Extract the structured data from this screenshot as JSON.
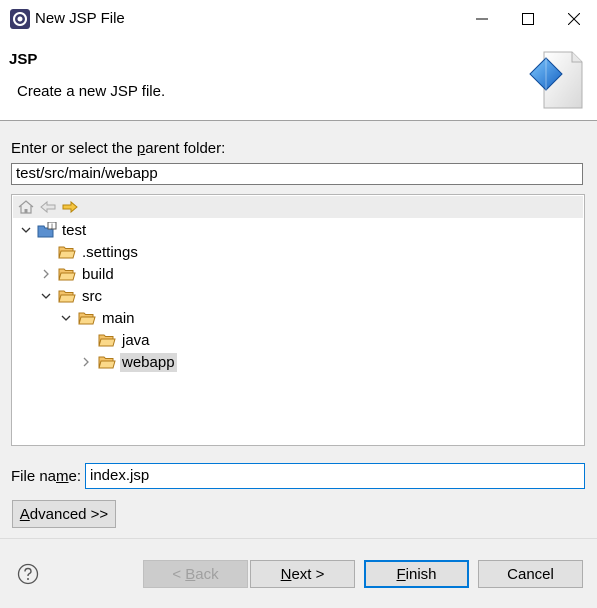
{
  "window": {
    "title": "New JSP File"
  },
  "banner": {
    "title": "JSP",
    "description": "Create a new JSP file."
  },
  "folder": {
    "label_prefix": "Enter or select the ",
    "label_mnemonic": "p",
    "label_suffix": "arent folder:",
    "value": "test/src/main/webapp"
  },
  "tree": {
    "nodes": [
      {
        "label": "test",
        "level": 0,
        "expanded": true,
        "icon": "project-icon"
      },
      {
        "label": ".settings",
        "level": 1,
        "expanded": null,
        "icon": "folder-icon"
      },
      {
        "label": "build",
        "level": 1,
        "expanded": false,
        "icon": "folder-icon"
      },
      {
        "label": "src",
        "level": 1,
        "expanded": true,
        "icon": "folder-icon"
      },
      {
        "label": "main",
        "level": 2,
        "expanded": true,
        "icon": "folder-icon"
      },
      {
        "label": "java",
        "level": 3,
        "expanded": null,
        "icon": "folder-icon"
      },
      {
        "label": "webapp",
        "level": 3,
        "expanded": false,
        "icon": "folder-icon",
        "selected": true
      }
    ]
  },
  "file_name": {
    "label_prefix": "File na",
    "label_mnemonic": "m",
    "label_suffix": "e:",
    "value": "index.jsp"
  },
  "buttons": {
    "advanced_mnemonic": "A",
    "advanced_rest": "dvanced >>",
    "back_prefix": "< ",
    "back_mnemonic": "B",
    "back_rest": "ack",
    "next_mnemonic": "N",
    "next_rest": "ext >",
    "finish_mnemonic": "F",
    "finish_rest": "inish",
    "cancel": "Cancel"
  },
  "colors": {
    "accent": "#0078d7",
    "folder": "#e8a33a",
    "selection": "#d9d9d9"
  }
}
